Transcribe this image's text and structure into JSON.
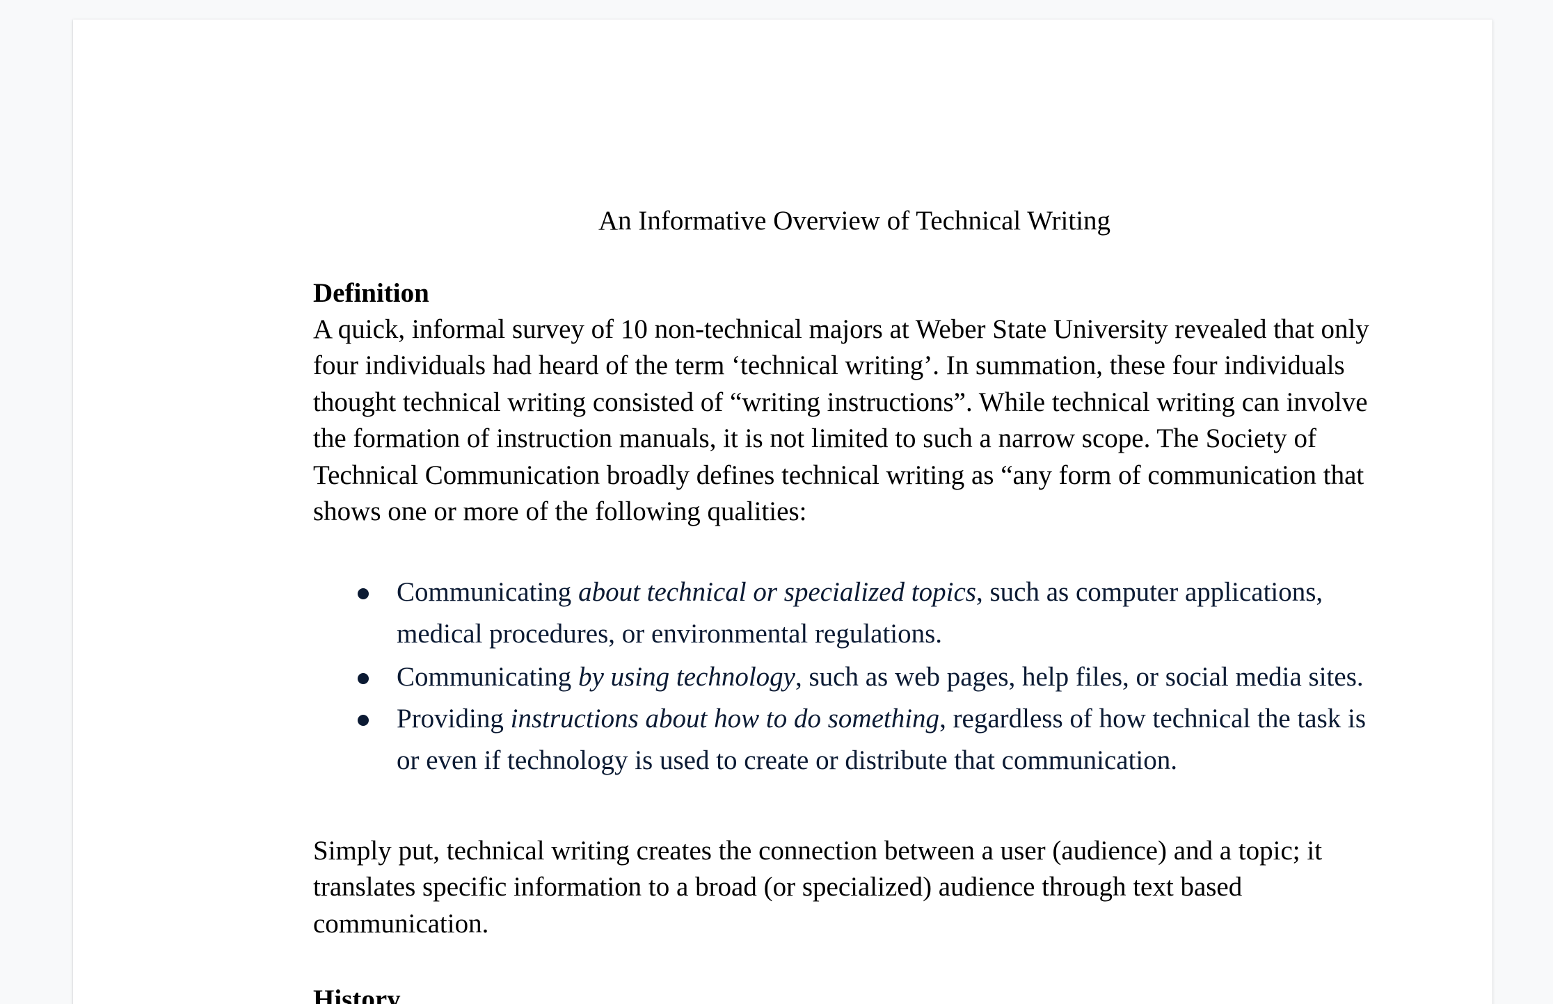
{
  "document": {
    "title": "An Informative Overview of Technical Writing",
    "sections": {
      "definition": {
        "heading": "Definition",
        "paragraph_1_lines": [
          "A quick, informal survey of 10 non-technical majors at Weber State University revealed that only",
          "four individuals had heard of the term ‘technical writing’. In summation, these four individuals",
          "thought technical writing consisted of “writing instructions”. While technical writing can involve",
          "the formation of instruction manuals, it is not limited to such a narrow scope. The Society of",
          "Technical Communication broadly defines technical writing as “any form of communication that",
          "shows one or more of the following qualities:"
        ],
        "bullets": [
          {
            "prefix": "Communicating ",
            "emphasis": "about technical or specialized topics",
            "suffix_line1": ", such as computer applications,",
            "suffix_line2": "medical procedures, or environmental regulations."
          },
          {
            "prefix": "Communicating ",
            "emphasis": "by using technology",
            "suffix_line1": ", such as web pages, help files, or social media sites.",
            "suffix_line2": ""
          },
          {
            "prefix": "Providing ",
            "emphasis": "instructions about how to do something",
            "suffix_line1": ", regardless of how technical the task is",
            "suffix_line2": "or even if technology is used to create or distribute that communication."
          }
        ],
        "paragraph_2_lines": [
          "Simply put, technical writing creates the connection between a user (audience) and a topic; it",
          "translates specific information to a broad (or specialized) audience through text based",
          "communication."
        ]
      },
      "history": {
        "heading": "History"
      }
    }
  },
  "colors": {
    "canvas_background": "#f8f9fa",
    "page_background": "#ffffff",
    "body_text": "#000000",
    "bullet_text": "#0b1a33"
  }
}
